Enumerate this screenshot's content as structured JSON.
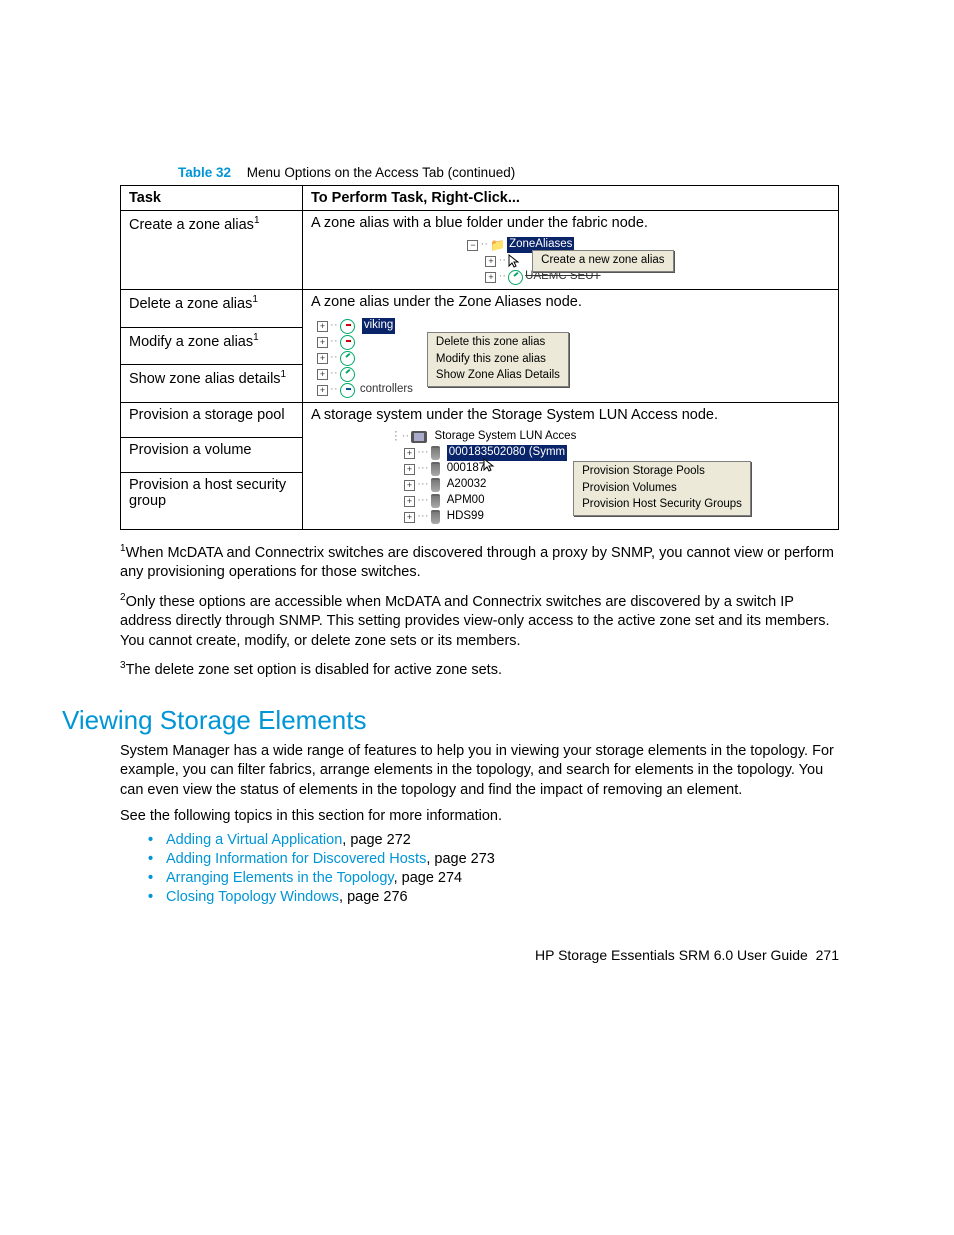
{
  "caption": {
    "num": "Table 32",
    "text": "Menu Options on the Access Tab (continued)"
  },
  "thead": {
    "task": "Task",
    "perform": "To Perform Task, Right-Click..."
  },
  "row1": {
    "task": "Create a zone alias",
    "sup": "1",
    "desc": "A zone alias with a blue folder under the fabric node.",
    "tree": {
      "root": "ZoneAliases",
      "menu": "Create a new zone alias"
    }
  },
  "row2": {
    "t1": "Delete a zone alias",
    "s1": "1",
    "t2": "Modify a zone alias",
    "s2": "1",
    "t3": "Show zone alias details",
    "s3": "1",
    "desc": "A zone alias under the Zone Aliases node.",
    "sel": "viking",
    "m1": "Delete this zone alias",
    "m2": "Modify this zone alias",
    "m3": "Show Zone Alias Details"
  },
  "row3": {
    "t1": "Provision a storage pool",
    "t2": "Provision a volume",
    "t3": "Provision a host security group",
    "desc": "A storage system under the Storage System LUN Access node.",
    "root": "Storage System LUN Acces",
    "sel": "000183502080 (Symm",
    "i2": "000187",
    "i3": "A20032",
    "i4": "APM00",
    "i5": "HDS99",
    "m1": "Provision Storage Pools",
    "m2": "Provision Volumes",
    "m3": "Provision Host Security Groups"
  },
  "fn1_sup": "1",
  "fn1": "When McDATA and Connectrix switches are discovered through a proxy by SNMP, you cannot view or perform any provisioning operations for those switches.",
  "fn2_sup": "2",
  "fn2": "Only these options are accessible when McDATA and Connectrix switches are discovered by a switch IP address directly through SNMP. This setting provides view-only access to the active zone set and its members. You cannot create, modify, or delete zone sets or its members.",
  "fn3_sup": "3",
  "fn3": "The delete zone set option is disabled for active zone sets.",
  "section": "Viewing Storage Elements",
  "p1": "System Manager has a wide range of features to help you in viewing your storage elements in the topology. For example, you can filter fabrics, arrange elements in the topology, and search for elements in the topology. You can even view the status of elements in the topology and find the impact of removing an element.",
  "p2": "See the following topics in this section for more information.",
  "links": {
    "l1": "Adding a Virtual Application",
    "p1": ", page 272",
    "l2": "Adding Information for Discovered Hosts",
    "p2": ", page 273",
    "l3": "Arranging Elements in the Topology",
    "p3": ", page 274",
    "l4": "Closing Topology Windows",
    "p4": ", page 276"
  },
  "footer": {
    "doc": "HP Storage Essentials SRM 6.0 User Guide",
    "page": "271"
  }
}
